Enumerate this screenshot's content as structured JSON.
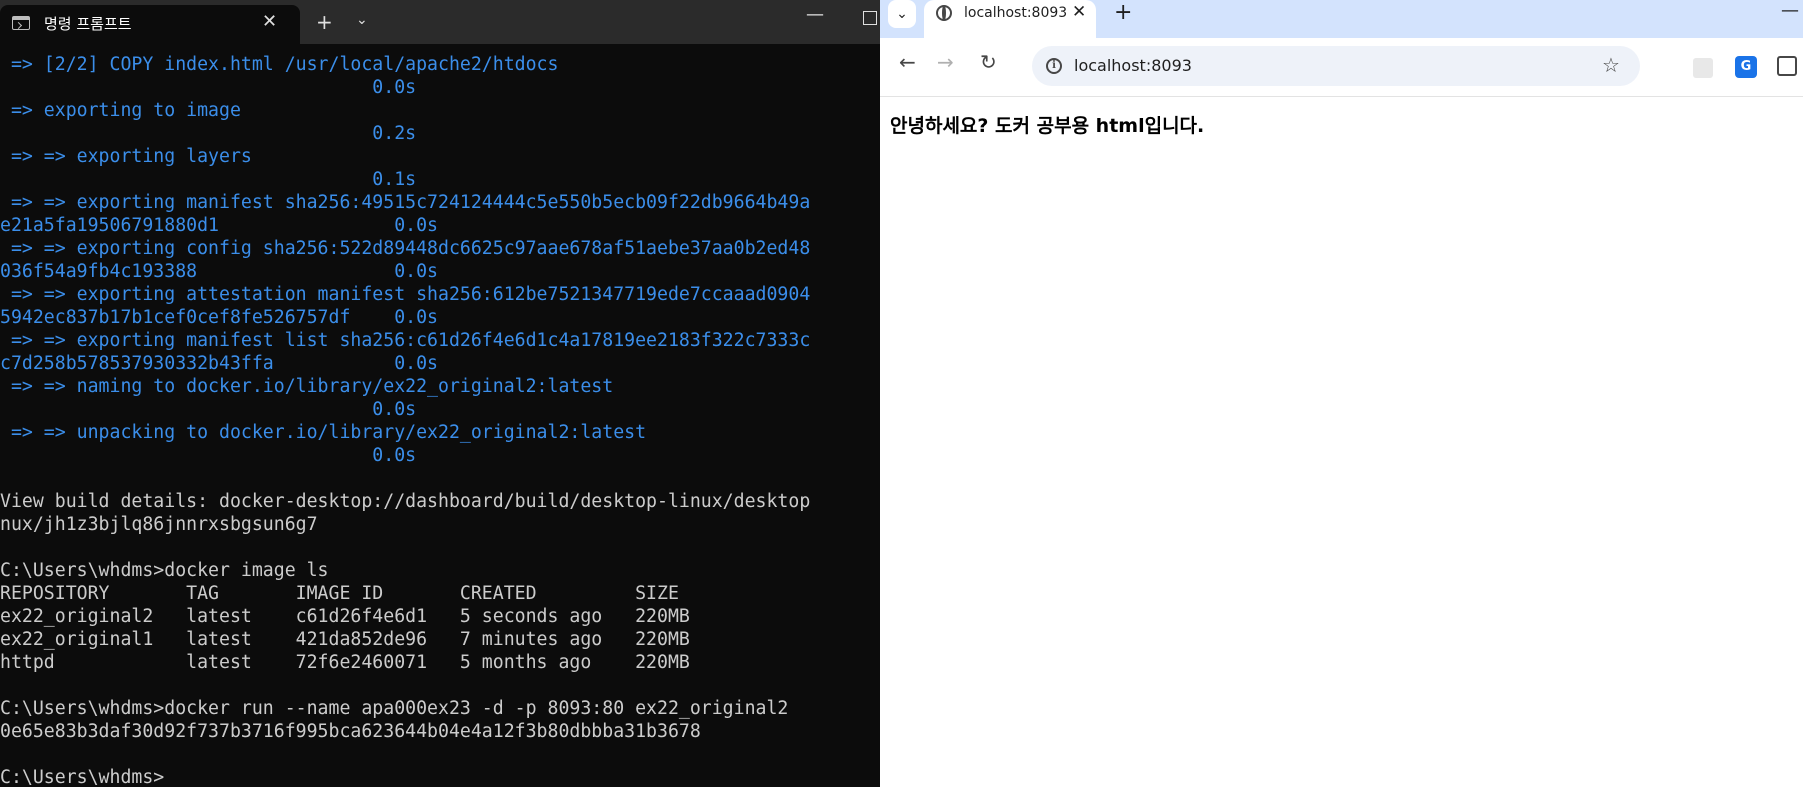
{
  "terminal": {
    "tab_title": "명령 프롬프트",
    "close_glyph": "✕",
    "newtab_glyph": "+",
    "dropdown_glyph": "⌄",
    "minimize_glyph": "—",
    "lines": [
      {
        "text": " => [2/2] COPY index.html /usr/local/apache2/htdocs",
        "style": "build"
      },
      {
        "text": "                                  0.0s",
        "style": "build"
      },
      {
        "text": " => exporting to image",
        "style": "build"
      },
      {
        "text": "                                  0.2s",
        "style": "build"
      },
      {
        "text": " => => exporting layers",
        "style": "build"
      },
      {
        "text": "                                  0.1s",
        "style": "build"
      },
      {
        "text": " => => exporting manifest sha256:49515c724124444c5e550b5ecb09f22db9664b49a",
        "style": "build"
      },
      {
        "text": "e21a5fa19506791880d1                0.0s",
        "style": "build"
      },
      {
        "text": " => => exporting config sha256:522d89448dc6625c97aae678af51aebe37aa0b2ed48",
        "style": "build"
      },
      {
        "text": "036f54a9fb4c193388                  0.0s",
        "style": "build"
      },
      {
        "text": " => => exporting attestation manifest sha256:612be7521347719ede7ccaaad0904",
        "style": "build"
      },
      {
        "text": "5942ec837b17b1cef0cef8fe526757df    0.0s",
        "style": "build"
      },
      {
        "text": " => => exporting manifest list sha256:c61d26f4e6d1c4a17819ee2183f322c7333c",
        "style": "build"
      },
      {
        "text": "c7d258b578537930332b43ffa           0.0s",
        "style": "build"
      },
      {
        "text": " => => naming to docker.io/library/ex22_original2:latest",
        "style": "build"
      },
      {
        "text": "                                  0.0s",
        "style": "build"
      },
      {
        "text": " => => unpacking to docker.io/library/ex22_original2:latest",
        "style": "build"
      },
      {
        "text": "                                  0.0s",
        "style": "build"
      },
      {
        "text": "",
        "style": "plain"
      },
      {
        "text": "View build details: docker-desktop://dashboard/build/desktop-linux/desktop",
        "style": "plain"
      },
      {
        "text": "nux/jh1z3bjlq86jnnrxsbgsun6g7",
        "style": "plain"
      },
      {
        "text": "",
        "style": "plain"
      },
      {
        "text": "C:\\Users\\whdms>docker image ls",
        "style": "plain"
      },
      {
        "text": "REPOSITORY       TAG       IMAGE ID       CREATED         SIZE",
        "style": "plain"
      },
      {
        "text": "ex22_original2   latest    c61d26f4e6d1   5 seconds ago   220MB",
        "style": "plain"
      },
      {
        "text": "ex22_original1   latest    421da852de96   7 minutes ago   220MB",
        "style": "plain"
      },
      {
        "text": "httpd            latest    72f6e2460071   5 months ago    220MB",
        "style": "plain"
      },
      {
        "text": "",
        "style": "plain"
      },
      {
        "text": "C:\\Users\\whdms>docker run --name apa000ex23 -d -p 8093:80 ex22_original2",
        "style": "plain"
      },
      {
        "text": "0e65e83b3daf30d92f737b3716f995bca623644b04e4a12f3b80dbbba31b3678",
        "style": "plain"
      },
      {
        "text": "",
        "style": "plain"
      },
      {
        "text": "C:\\Users\\whdms>",
        "style": "plain"
      }
    ]
  },
  "browser": {
    "tab_search_glyph": "⌄",
    "tab_title": "localhost:8093",
    "close_glyph": "✕",
    "newtab_glyph": "+",
    "minimize_glyph": "—",
    "back_glyph": "←",
    "forward_glyph": "→",
    "reload_glyph": "↻",
    "info_glyph": "i",
    "url": "localhost:8093",
    "star_glyph": "☆",
    "translate_glyph": "G",
    "page_text": "안녕하세요? 도커 공부용 html입니다."
  }
}
